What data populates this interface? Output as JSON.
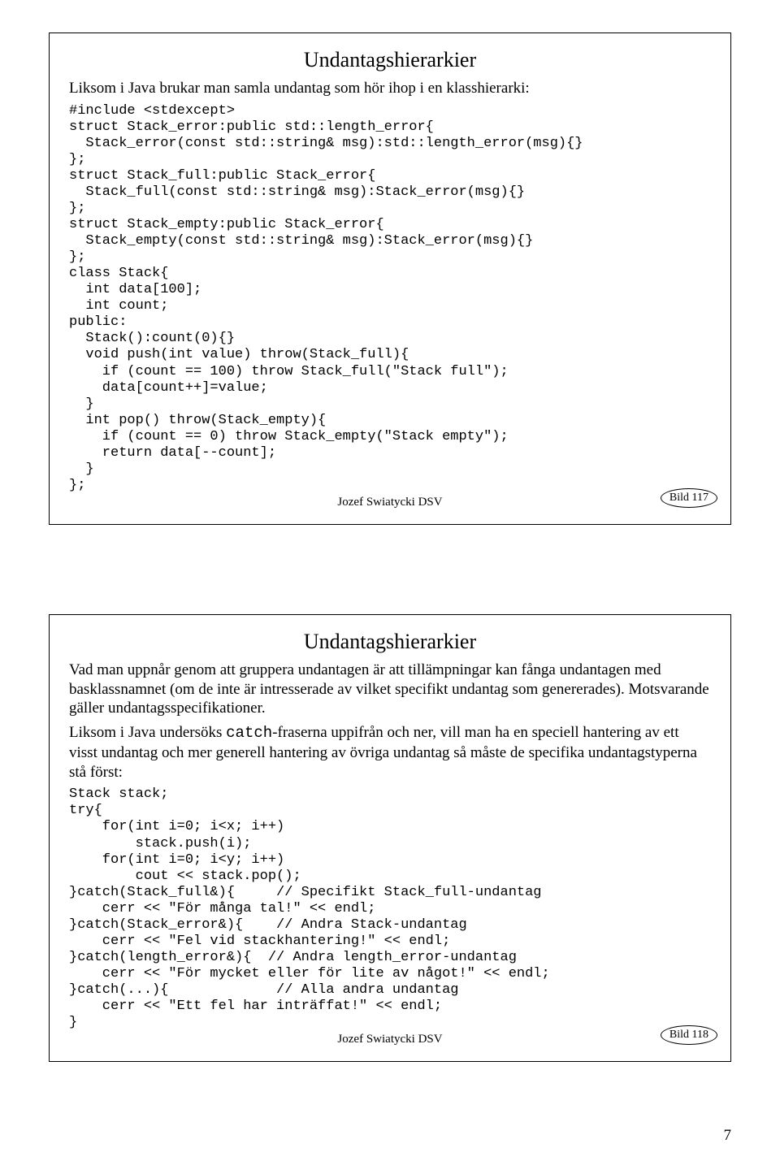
{
  "slide1": {
    "title": "Undantagshierarkier",
    "intro": "Liksom i Java brukar man samla undantag som hör ihop i en klasshierarki:",
    "code": "#include <stdexcept>\nstruct Stack_error:public std::length_error{\n  Stack_error(const std::string& msg):std::length_error(msg){}\n};\nstruct Stack_full:public Stack_error{\n  Stack_full(const std::string& msg):Stack_error(msg){}\n};\nstruct Stack_empty:public Stack_error{\n  Stack_empty(const std::string& msg):Stack_error(msg){}\n};\nclass Stack{\n  int data[100];\n  int count;\npublic:\n  Stack():count(0){}\n  void push(int value) throw(Stack_full){\n    if (count == 100) throw Stack_full(\"Stack full\");\n    data[count++]=value;\n  }\n  int pop() throw(Stack_empty){\n    if (count == 0) throw Stack_empty(\"Stack empty\");\n    return data[--count];\n  }\n};",
    "badge": "Bild 117",
    "author": "Jozef Swiatycki DSV"
  },
  "slide2": {
    "title": "Undantagshierarkier",
    "para1": "Vad man uppnår genom att gruppera undantagen är att tillämpningar kan fånga undantagen med basklassnamnet (om de inte är intresserade av vilket specifikt undantag som genererades). Motsvarande gäller undantagsspecifikationer.",
    "para2a": "Liksom i Java undersöks ",
    "para2code": "catch",
    "para2b": "-fraserna uppifrån och ner, vill man ha en speciell hantering av ett visst undantag och mer generell hantering av övriga undantag så måste de specifika undantagstyperna stå först:",
    "code": "Stack stack;\ntry{\n    for(int i=0; i<x; i++)\n        stack.push(i);\n    for(int i=0; i<y; i++)\n        cout << stack.pop();\n}catch(Stack_full&){     // Specifikt Stack_full-undantag\n    cerr << \"För många tal!\" << endl;\n}catch(Stack_error&){    // Andra Stack-undantag\n    cerr << \"Fel vid stackhantering!\" << endl;\n}catch(length_error&){  // Andra length_error-undantag\n    cerr << \"För mycket eller för lite av något!\" << endl;\n}catch(...){             // Alla andra undantag\n    cerr << \"Ett fel har inträffat!\" << endl;\n}",
    "badge": "Bild 118",
    "author": "Jozef Swiatycki DSV"
  },
  "pageNumber": "7"
}
